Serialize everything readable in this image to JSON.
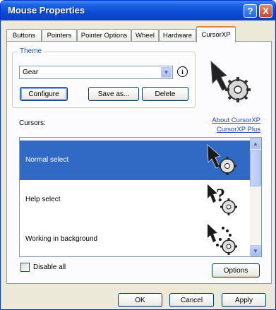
{
  "window": {
    "title": "Mouse Properties",
    "help_glyph": "?",
    "close_glyph": "X"
  },
  "tabs": [
    {
      "label": "Buttons"
    },
    {
      "label": "Pointers"
    },
    {
      "label": "Pointer Options"
    },
    {
      "label": "Wheel"
    },
    {
      "label": "Hardware"
    },
    {
      "label": "CursorXP",
      "active": true
    }
  ],
  "theme": {
    "group_title": "Theme",
    "selected_value": "Gear",
    "info_glyph": "i",
    "configure_label": "Configure",
    "save_as_label": "Save as...",
    "delete_label": "Delete"
  },
  "links": {
    "about": "About CursorXP",
    "plus": "CursorXP Plus"
  },
  "cursors": {
    "label": "Cursors:",
    "items": [
      {
        "label": "Normal select",
        "selected": true,
        "icon": "gear-arrow-cursor-icon"
      },
      {
        "label": "Help select",
        "selected": false,
        "icon": "gear-help-cursor-icon"
      },
      {
        "label": "Working in background",
        "selected": false,
        "icon": "gear-busy-cursor-icon"
      }
    ]
  },
  "disable_all_label": "Disable all",
  "options_label": "Options",
  "footer": {
    "ok_label": "OK",
    "cancel_label": "Cancel",
    "apply_label": "Apply"
  },
  "colors": {
    "titlebar": "#0b4bd6",
    "selection": "#316ac5",
    "active_tab_accent": "#e68b2c",
    "link": "#1f3fc8"
  }
}
